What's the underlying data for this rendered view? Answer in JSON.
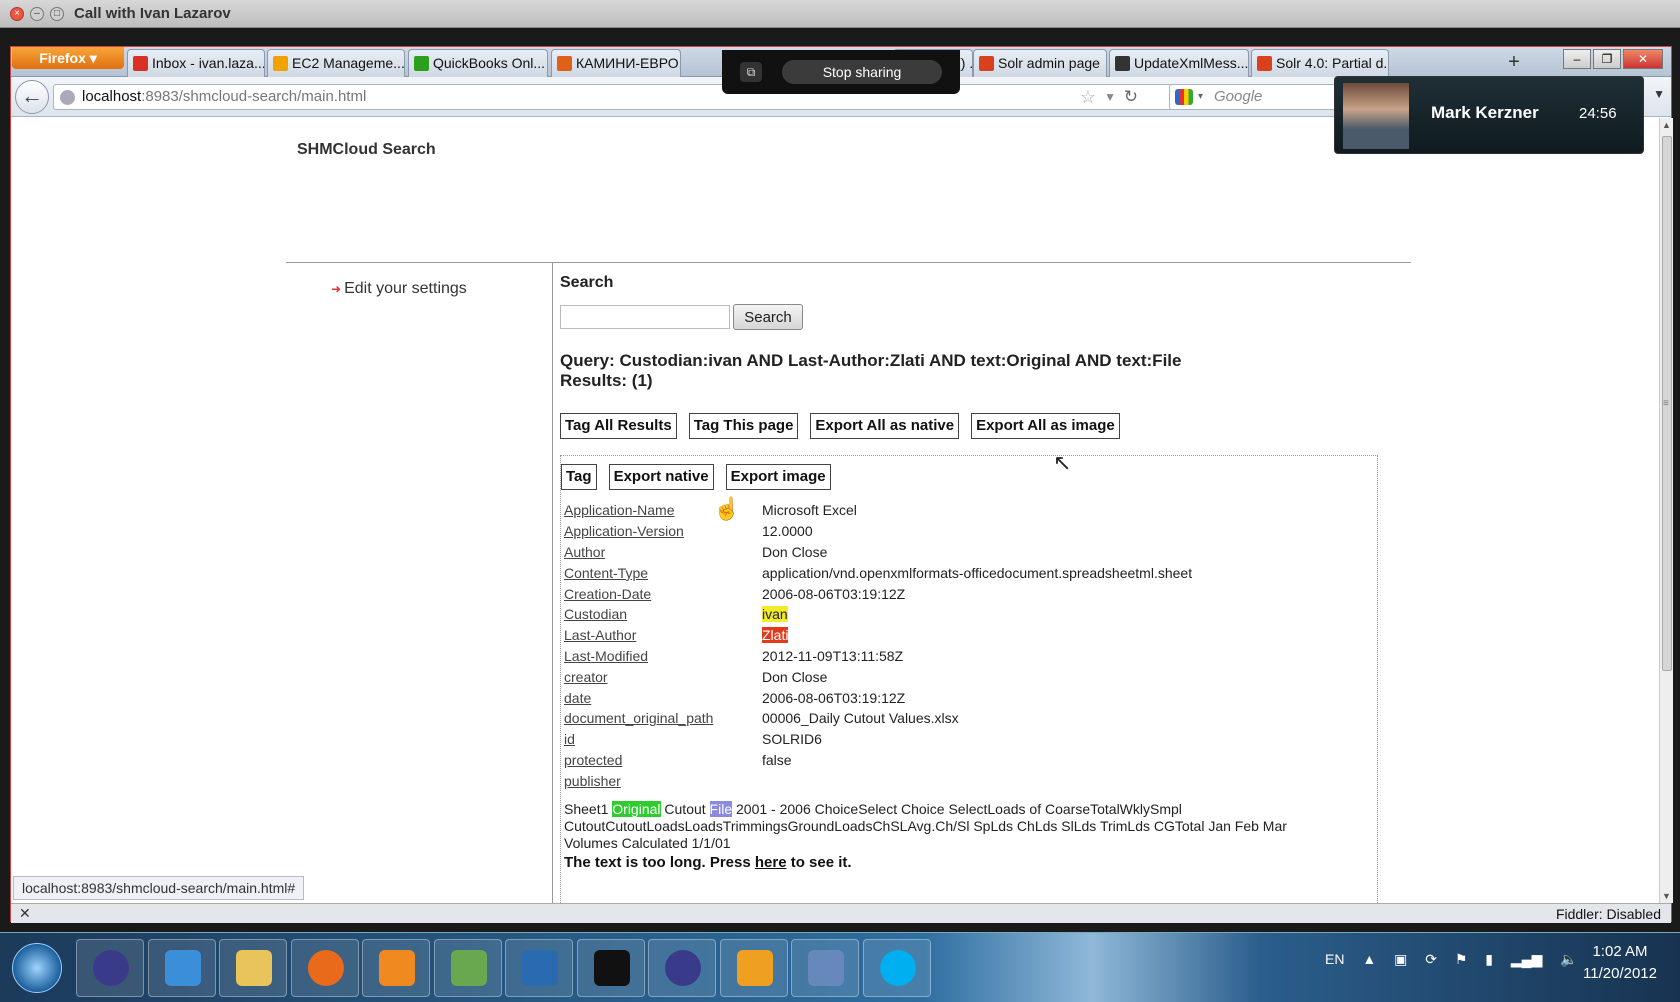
{
  "window": {
    "title": "Call with Ivan Lazarov"
  },
  "browser": {
    "app_button": "Firefox",
    "tabs": [
      {
        "label": "Inbox - ivan.laza...",
        "icon": "gmail-icon",
        "color": "#d93025"
      },
      {
        "label": "EC2 Manageme...",
        "icon": "aws-icon",
        "color": "#f2a200"
      },
      {
        "label": "QuickBooks Onl...",
        "icon": "quickbooks-icon",
        "color": "#2ca01c"
      },
      {
        "label": "КАМИНИ-ЕВРО...",
        "icon": "fire-icon",
        "color": "#e0601a"
      },
      {
        "label": "length() ...",
        "icon": "page-icon",
        "color": "#888888"
      },
      {
        "label": "Solr admin page",
        "icon": "solr-icon",
        "color": "#d9411e"
      },
      {
        "label": "UpdateXmlMess...",
        "icon": "github-icon",
        "color": "#333333"
      },
      {
        "label": "Solr 4.0: Partial d...",
        "icon": "solr-icon",
        "color": "#d9411e"
      }
    ],
    "url_host": "localhost",
    "url_rest": ":8983/shmcloud-search/main.html",
    "search_engine": "Google",
    "status_url": "localhost:8983/shmcloud-search/main.html#",
    "addon_status": "Fiddler: Disabled"
  },
  "screen_share": {
    "stop_label": "Stop sharing"
  },
  "video_call": {
    "name": "Mark Kerzner",
    "duration": "24:56"
  },
  "page": {
    "site_title": "SHMCloud Search",
    "sidebar_link": "Edit your settings",
    "search_heading": "Search",
    "search_input_value": "",
    "search_button": "Search",
    "query_line": "Query: Custodian:ivan AND Last-Author:Zlati AND text:Original AND text:File",
    "results_line": "Results: (1)",
    "bulk_buttons": [
      "Tag All Results",
      "Tag This page",
      "Export All as native",
      "Export All as image"
    ],
    "result_buttons": [
      "Tag",
      "Export native",
      "Export image"
    ],
    "metadata": [
      {
        "key": "Application-Name",
        "value": "Microsoft Excel",
        "hl": ""
      },
      {
        "key": "Application-Version",
        "value": "12.0000",
        "hl": ""
      },
      {
        "key": "Author",
        "value": "Don Close",
        "hl": ""
      },
      {
        "key": "Content-Type",
        "value": "application/vnd.openxmlformats-officedocument.spreadsheetml.sheet",
        "hl": ""
      },
      {
        "key": "Creation-Date",
        "value": "2006-08-06T03:19:12Z",
        "hl": ""
      },
      {
        "key": "Custodian",
        "value": "ivan",
        "hl": "y"
      },
      {
        "key": "Last-Author",
        "value": "Zlati",
        "hl": "r"
      },
      {
        "key": "Last-Modified",
        "value": "2012-11-09T13:11:58Z",
        "hl": ""
      },
      {
        "key": "creator",
        "value": "Don Close",
        "hl": ""
      },
      {
        "key": "date",
        "value": "2006-08-06T03:19:12Z",
        "hl": ""
      },
      {
        "key": "document_original_path",
        "value": "00006_Daily Cutout Values.xlsx",
        "hl": ""
      },
      {
        "key": "id",
        "value": "SOLRID6",
        "hl": ""
      },
      {
        "key": "protected",
        "value": "false",
        "hl": ""
      },
      {
        "key": "publisher",
        "value": "",
        "hl": ""
      }
    ],
    "body_pre": "Sheet1 ",
    "body_hl1": "Original",
    "body_mid": " Cutout ",
    "body_hl2": "File",
    "body_post": " 2001 - 2006 ChoiceSelect Choice SelectLoads of CoarseTotalWklySmpl CutoutCutoutLoadsLoadsTrimmingsGroundLoadsChSLAvg.Ch/Sl SpLds ChLds SlLds TrimLds CGTotal Jan Feb Mar Volumes Calculated 1/1/01",
    "too_long_pre": "The text is too long. Press ",
    "too_long_link": "here",
    "too_long_post": " to see it."
  },
  "taskbar": {
    "apps": [
      {
        "name": "eclipse-icon",
        "color": "#3a3a8a"
      },
      {
        "name": "ie-icon",
        "color": "#3a8fd8"
      },
      {
        "name": "explorer-icon",
        "color": "#e8c45a"
      },
      {
        "name": "firefox-icon",
        "color": "#e86a1a"
      },
      {
        "name": "media-icon",
        "color": "#f08a20"
      },
      {
        "name": "monitor-icon",
        "color": "#6aa84f"
      },
      {
        "name": "powershell-icon",
        "color": "#2a6ab0"
      },
      {
        "name": "cmd-icon",
        "color": "#111111"
      },
      {
        "name": "eclipse2-icon",
        "color": "#3a3a8a"
      },
      {
        "name": "outlook-icon",
        "color": "#f0a020"
      },
      {
        "name": "virtualbox-icon",
        "color": "#6688bb"
      },
      {
        "name": "skype-icon",
        "color": "#00aff0"
      }
    ],
    "lang": "EN",
    "time": "1:02 AM",
    "date": "11/20/2012"
  }
}
